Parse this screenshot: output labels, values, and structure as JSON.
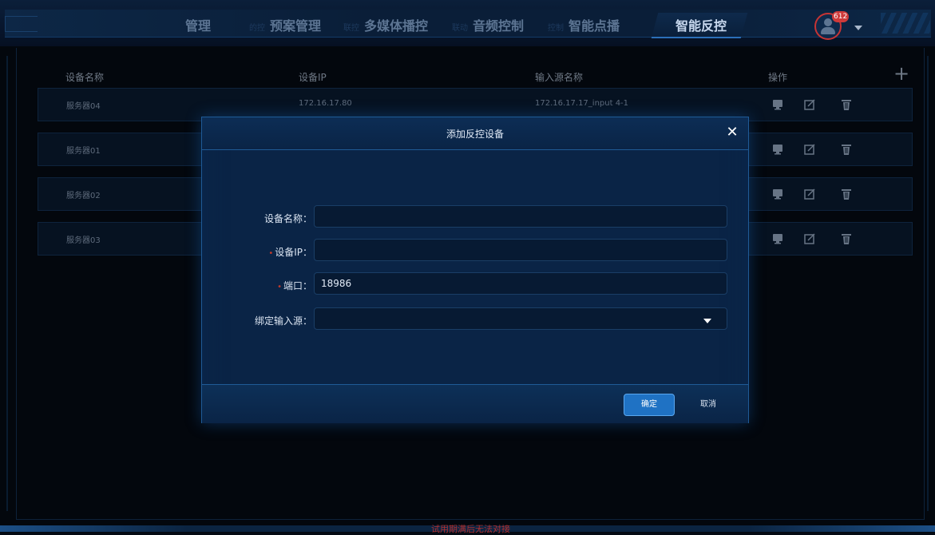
{
  "nav": {
    "tabs": [
      {
        "label": "管理",
        "ghost": ""
      },
      {
        "label": "预案管理",
        "ghost": "的控"
      },
      {
        "label": "多媒体播控",
        "ghost": "联控"
      },
      {
        "label": "音频控制",
        "ghost": "联动"
      },
      {
        "label": "智能点播",
        "ghost": "控制"
      },
      {
        "label": "智能反控",
        "ghost": ""
      }
    ],
    "active_tab": "智能反控",
    "notification_count": "612"
  },
  "table": {
    "columns": [
      "设备名称",
      "设备IP",
      "输入源名称",
      "操作"
    ],
    "rows": [
      {
        "name": "服务器04",
        "ip": "172.16.17.80",
        "source": "172.16.17.17_input 4-1"
      },
      {
        "name": "服务器01",
        "ip": "",
        "source": ""
      },
      {
        "name": "服务器02",
        "ip": "",
        "source": ""
      },
      {
        "name": "服务器03",
        "ip": "",
        "source": ""
      }
    ]
  },
  "modal": {
    "title": "添加反控设备",
    "fields": {
      "name_label": "设备名称：",
      "name_value": "",
      "ip_label": "设备IP：",
      "ip_value": "",
      "port_label": "端口：",
      "port_value": "18986",
      "source_label": "绑定输入源：",
      "source_value": ""
    },
    "confirm_label": "确定",
    "cancel_label": "取消"
  },
  "footer_note": "试用期满后无法对接",
  "colors": {
    "accent": "#1f72c4",
    "background": "#050b14",
    "required": "#c0392b",
    "badge": "#d03a3a"
  }
}
